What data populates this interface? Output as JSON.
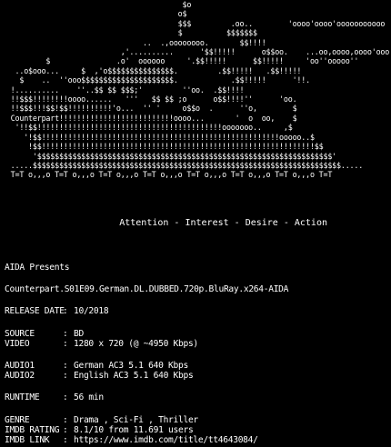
{
  "ascii_art": "                                         $o\n                                        o$\n                                        $$$         .oo..        'oooo'oooo'ooooooooooo\n                                        $          $$$$$$$\n                                ..  .,oooooooo.       $$!!!!\n                           ,'..........      '$$!!!!!      o$$oo.    ...oo,oooo,oooo'ooo''\n          $               .o'  oooooo     '.$$!!!!!      $$!!!!!     'oo''ooooo''\n   ..o$ooo...     $  ,'o$$$$$$$$$$$$$$$.         .$$!!!!!   .$$!!!!!\n    $    ..  ''ooo$$$$$$$$$$$$$$$$$$$$$.            .$$!!!!!      '!!.\n  !..........    ''..$$ $$ $$$;'         ''oo.  .$$!!!!\n  !!$$$!!!!!!!!oooo......   '''   $$ $$ ;o      o$$!!!!''      'oo.\n  !!$$$!!!$$!$$!!!!!!!!!!'o...  '' '     o$$o  .      ''o,        $\n  Counterpart!!!!!!!!!!!!!!!!!!!!!!!!!!oooo...       '  o  oo,    $\n   '!!$$!!!!!!!!!!!!!!!!!!!!!!!!!!!!!!!!!!!!!!!!!!ooooooo..     ,$\n     '!$$!!!!!!!!!!!!!!!!!!!!!!!!!!!!!!!!!!!!!!!!!!!!!!!!!!!!!!ooooo..$\n      !$$!!!!!!!!!!!!!!!!!!!!!!!!!!!!!!!!!!!!!!!!!!!!!!!!!!!!!!!!!!!!!!$$\n       '$$$$$$$$$$$$$$$$$$$$$$$$$$$$$$$$$$$$$$$$$$$$$$$$$$$$$$$$$$$$$$$$$$$'\n  .....$$$$$$$$$$$$$$$$$$$$$$$$$$$$$$$$$$$$$$$$$$$$$$$$$$$$$$$$$$$$$$$$$$$$$$.....\n  T=T o,,,o T=T o,,,o T=T o,,,o T=T o,,,o T=T o,,,o T=T o,,,o T=T o,,,o T=T",
  "tagline": "Attention - Interest - Desire - Action",
  "presents": "AIDA Presents",
  "release_name": "Counterpart.S01E09.German.DL.DUBBED.720p.BluRay.x264-AIDA",
  "release_date": {
    "label": "RELEASE DATE",
    "sep": ":",
    "value": "10/2018"
  },
  "source": {
    "label": "SOURCE",
    "sep": ":",
    "value": "BD"
  },
  "video": {
    "label": "VIDEO",
    "sep": ":",
    "value": "1280 x 720 (@ ~4950 Kbps)"
  },
  "audio1": {
    "label": "AUDIO1",
    "sep": ":",
    "value": "German  AC3 5.1 640 Kbps"
  },
  "audio2": {
    "label": "AUDIO2",
    "sep": ":",
    "value": "English AC3 5.1 640 Kbps"
  },
  "runtime": {
    "label": "RUNTIME",
    "sep": ":",
    "value": "56 min"
  },
  "genre": {
    "label": "GENRE",
    "sep": ":",
    "value": "Drama , Sci-Fi , Thriller"
  },
  "imdb_rating": {
    "label": "IMDB RATING",
    "sep": ":",
    "value": "8.1/10 from 11.691 users"
  },
  "imdb_link": {
    "label": "IMDB LINK",
    "sep": ":",
    "value": "https://www.imdb.com/title/tt4643084/"
  },
  "colors": {
    "background": "#000000",
    "text": "#ffffff"
  }
}
